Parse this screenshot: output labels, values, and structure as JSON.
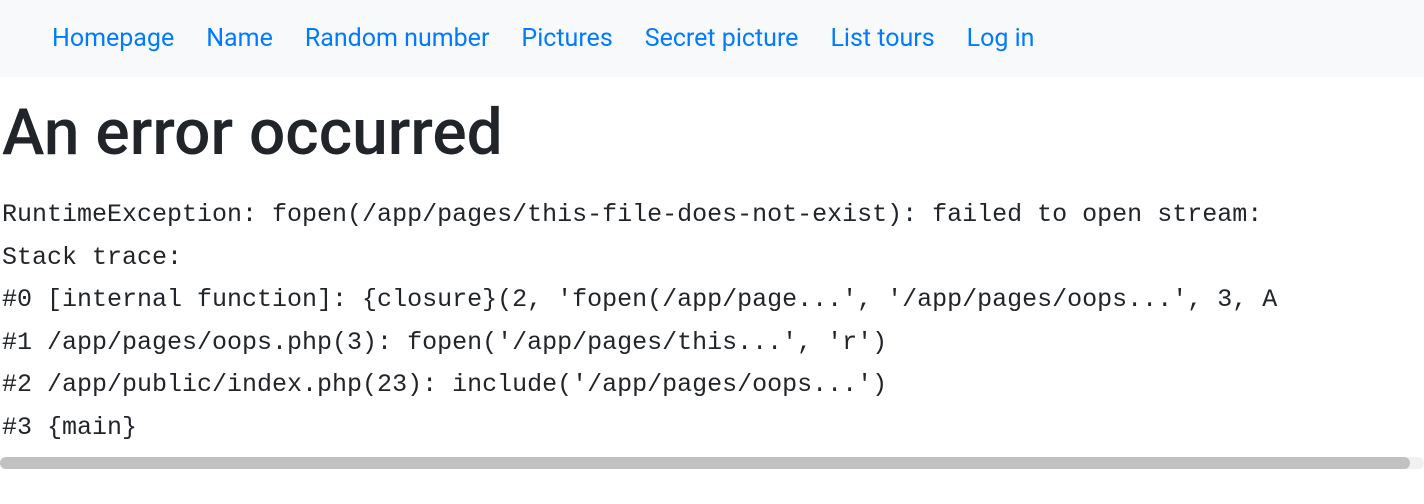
{
  "nav": {
    "links": [
      {
        "label": "Homepage"
      },
      {
        "label": "Name"
      },
      {
        "label": "Random number"
      },
      {
        "label": "Pictures"
      },
      {
        "label": "Secret picture"
      },
      {
        "label": "List tours"
      },
      {
        "label": "Log in"
      }
    ]
  },
  "page": {
    "heading": "An error occurred"
  },
  "error": {
    "lines": [
      "RuntimeException: fopen(/app/pages/this-file-does-not-exist): failed to open stream: ",
      "Stack trace:",
      "#0 [internal function]: {closure}(2, 'fopen(/app/page...', '/app/pages/oops...', 3, A",
      "#1 /app/pages/oops.php(3): fopen('/app/pages/this...', 'r')",
      "#2 /app/public/index.php(23): include('/app/pages/oops...')",
      "#3 {main}"
    ]
  }
}
